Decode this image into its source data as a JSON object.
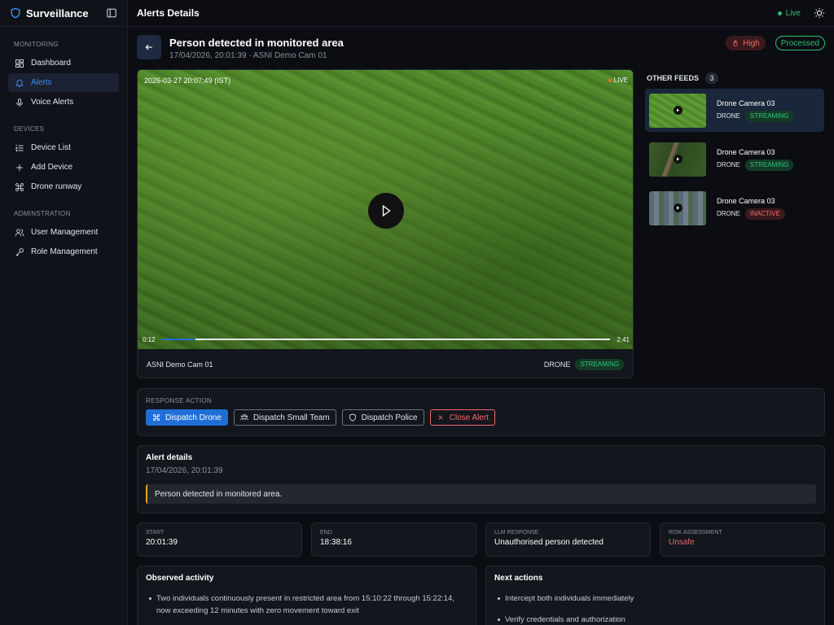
{
  "app": {
    "name": "Surveillance"
  },
  "sidebar": {
    "sections": [
      {
        "heading": "MONITORING",
        "items": [
          {
            "label": "Dashboard"
          },
          {
            "label": "Alerts"
          },
          {
            "label": "Voice Alerts"
          }
        ]
      },
      {
        "heading": "DEVICES",
        "items": [
          {
            "label": "Device List"
          },
          {
            "label": "Add Device"
          },
          {
            "label": "Drone runway"
          }
        ]
      },
      {
        "heading": "ADMINSTRATION",
        "items": [
          {
            "label": "User Management"
          },
          {
            "label": "Role Management"
          }
        ]
      }
    ]
  },
  "topbar": {
    "title": "Alerts Details",
    "live_label": "Live"
  },
  "alert": {
    "title": "Person detected in monitored area",
    "subtitle": "17/04/2026, 20:01:39 · ASNI Demo Cam 01",
    "severity": "High",
    "status": "Processed"
  },
  "video": {
    "timestamp": "2026-03-27 20:07:49 (IST)",
    "live_label": "LIVE",
    "time_current": "0:12",
    "time_total": "2:41",
    "progress_fraction": 0.075,
    "camera_name": "ASNI Demo Cam 01",
    "device_type": "DRONE",
    "stream_status": "STREAMING"
  },
  "other_feeds": {
    "label": "OTHER FEEDS",
    "count": "3",
    "items": [
      {
        "name": "Drone Camera 03",
        "type": "DRONE",
        "status": "STREAMING"
      },
      {
        "name": "Drone Camera 03",
        "type": "DRONE",
        "status": "STREAMING"
      },
      {
        "name": "Drone Camera 03",
        "type": "DRONE",
        "status": "INACTIVE"
      }
    ]
  },
  "response": {
    "label": "RESPONSE ACTION",
    "dispatch_drone": "Dispatch Drone",
    "dispatch_team": "Dispatch Small Team",
    "dispatch_police": "Dispatch Police",
    "close_alert": "Close Alert"
  },
  "details": {
    "title": "Alert details",
    "date": "17/04/2026, 20:01:39",
    "note": "Person detected in monitored area."
  },
  "stats": [
    {
      "label": "START",
      "value": "20:01:39"
    },
    {
      "label": "END",
      "value": "18:38:16"
    },
    {
      "label": "LLM RESPONSE",
      "value": "Unauthorised person detected"
    },
    {
      "label": "RISK ASSESSMENT",
      "value": "Unsafe"
    }
  ],
  "observed": {
    "title": "Observed activity",
    "items": [
      "Two individuals continuously present in restricted area from 15:10:22 through 15:22:14, now exceeding 12 minutes with zero movement toward exit"
    ]
  },
  "next_actions": {
    "title": "Next actions",
    "items": [
      "Intercept both individuals immediately",
      "Verify credentials and authorization"
    ]
  },
  "colors": {
    "accent": "#1f6fd6",
    "live": "#2fbf71",
    "danger": "#ef6a6a",
    "warning": "#f0a020"
  }
}
